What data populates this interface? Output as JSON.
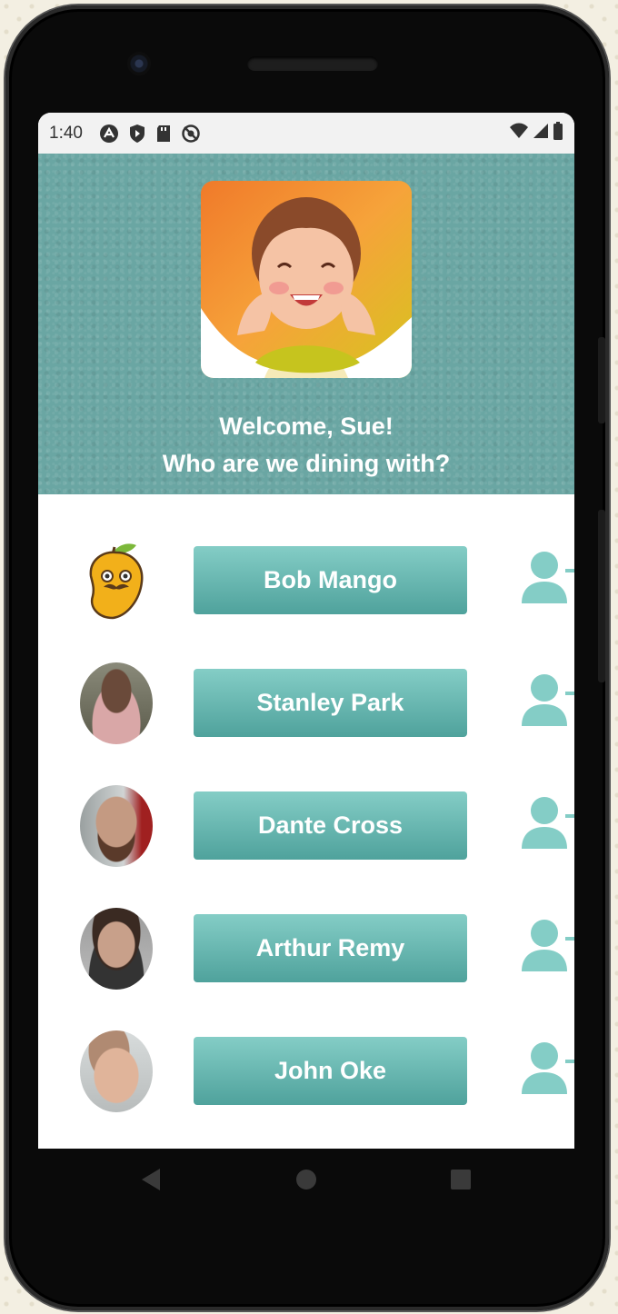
{
  "status": {
    "time": "1:40",
    "icons": [
      "a-icon",
      "shield-icon",
      "sd-card-icon",
      "no-tracking-icon"
    ],
    "right_icons": [
      "wifi-icon",
      "signal-icon",
      "battery-icon"
    ]
  },
  "header": {
    "welcome_line1": "Welcome, Sue!",
    "welcome_line2": "Who are we dining with?"
  },
  "contacts": [
    {
      "name": "Bob Mango",
      "avatar": "mango-avatar"
    },
    {
      "name": "Stanley Park",
      "avatar": "woman-photo-avatar"
    },
    {
      "name": "Dante Cross",
      "avatar": "bearded-man-photo-avatar"
    },
    {
      "name": "Arthur Remy",
      "avatar": "man-photo-avatar"
    },
    {
      "name": "John Oke",
      "avatar": "young-man-photo-avatar"
    }
  ],
  "colors": {
    "accent": "#6aa6a3",
    "button_top": "#84cdc6",
    "button_bottom": "#4fa29c",
    "add_icon": "#84cdc6"
  },
  "navbar": {
    "icons": [
      "back-icon",
      "home-icon",
      "recents-icon"
    ]
  }
}
